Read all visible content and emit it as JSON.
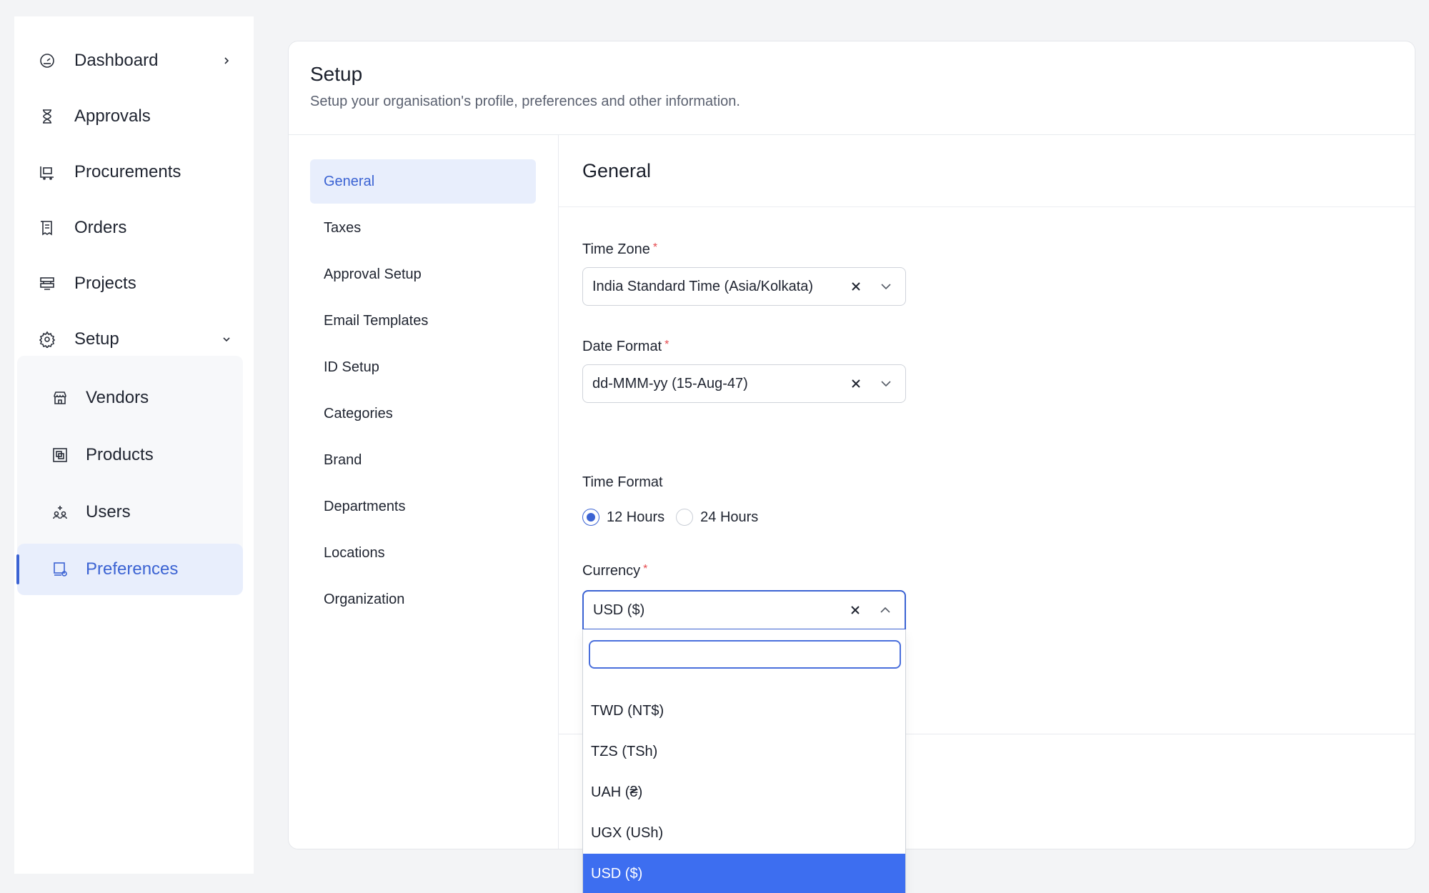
{
  "sidebar": {
    "items": [
      {
        "label": "Dashboard"
      },
      {
        "label": "Approvals"
      },
      {
        "label": "Procurements"
      },
      {
        "label": "Orders"
      },
      {
        "label": "Projects"
      },
      {
        "label": "Setup"
      }
    ],
    "sub_items": [
      {
        "label": "Vendors"
      },
      {
        "label": "Products"
      },
      {
        "label": "Users"
      },
      {
        "label": "Preferences"
      }
    ],
    "active_item": "Preferences"
  },
  "header": {
    "title": "Setup",
    "subtitle": "Setup your organisation's profile, preferences and other information."
  },
  "setup_menu": {
    "items": [
      "General",
      "Taxes",
      "Approval Setup",
      "Email Templates",
      "ID Setup",
      "Categories",
      "Brand",
      "Departments",
      "Locations",
      "Organization"
    ],
    "active": "General"
  },
  "general": {
    "title": "General",
    "time_zone": {
      "label": "Time Zone",
      "required_mark": "*",
      "value": "India Standard Time (Asia/Kolkata)"
    },
    "date_format": {
      "label": "Date Format",
      "required_mark": "*",
      "value": "dd-MMM-yy (15-Aug-47)"
    },
    "time_format": {
      "label": "Time Format",
      "options": [
        "12 Hours",
        "24 Hours"
      ],
      "selected": "12 Hours"
    },
    "currency": {
      "label": "Currency",
      "required_mark": "*",
      "value": "USD ($)",
      "search_value": "",
      "options": [
        "TWD (NT$)",
        "TZS (TSh)",
        "UAH (₴)",
        "UGX (USh)",
        "USD ($)"
      ],
      "selected_option": "USD ($)"
    }
  },
  "colors": {
    "accent": "#3b63d3",
    "selected_option_bg": "#3d6ef0",
    "active_bg": "#e8eefc",
    "required": "#e5484d"
  }
}
